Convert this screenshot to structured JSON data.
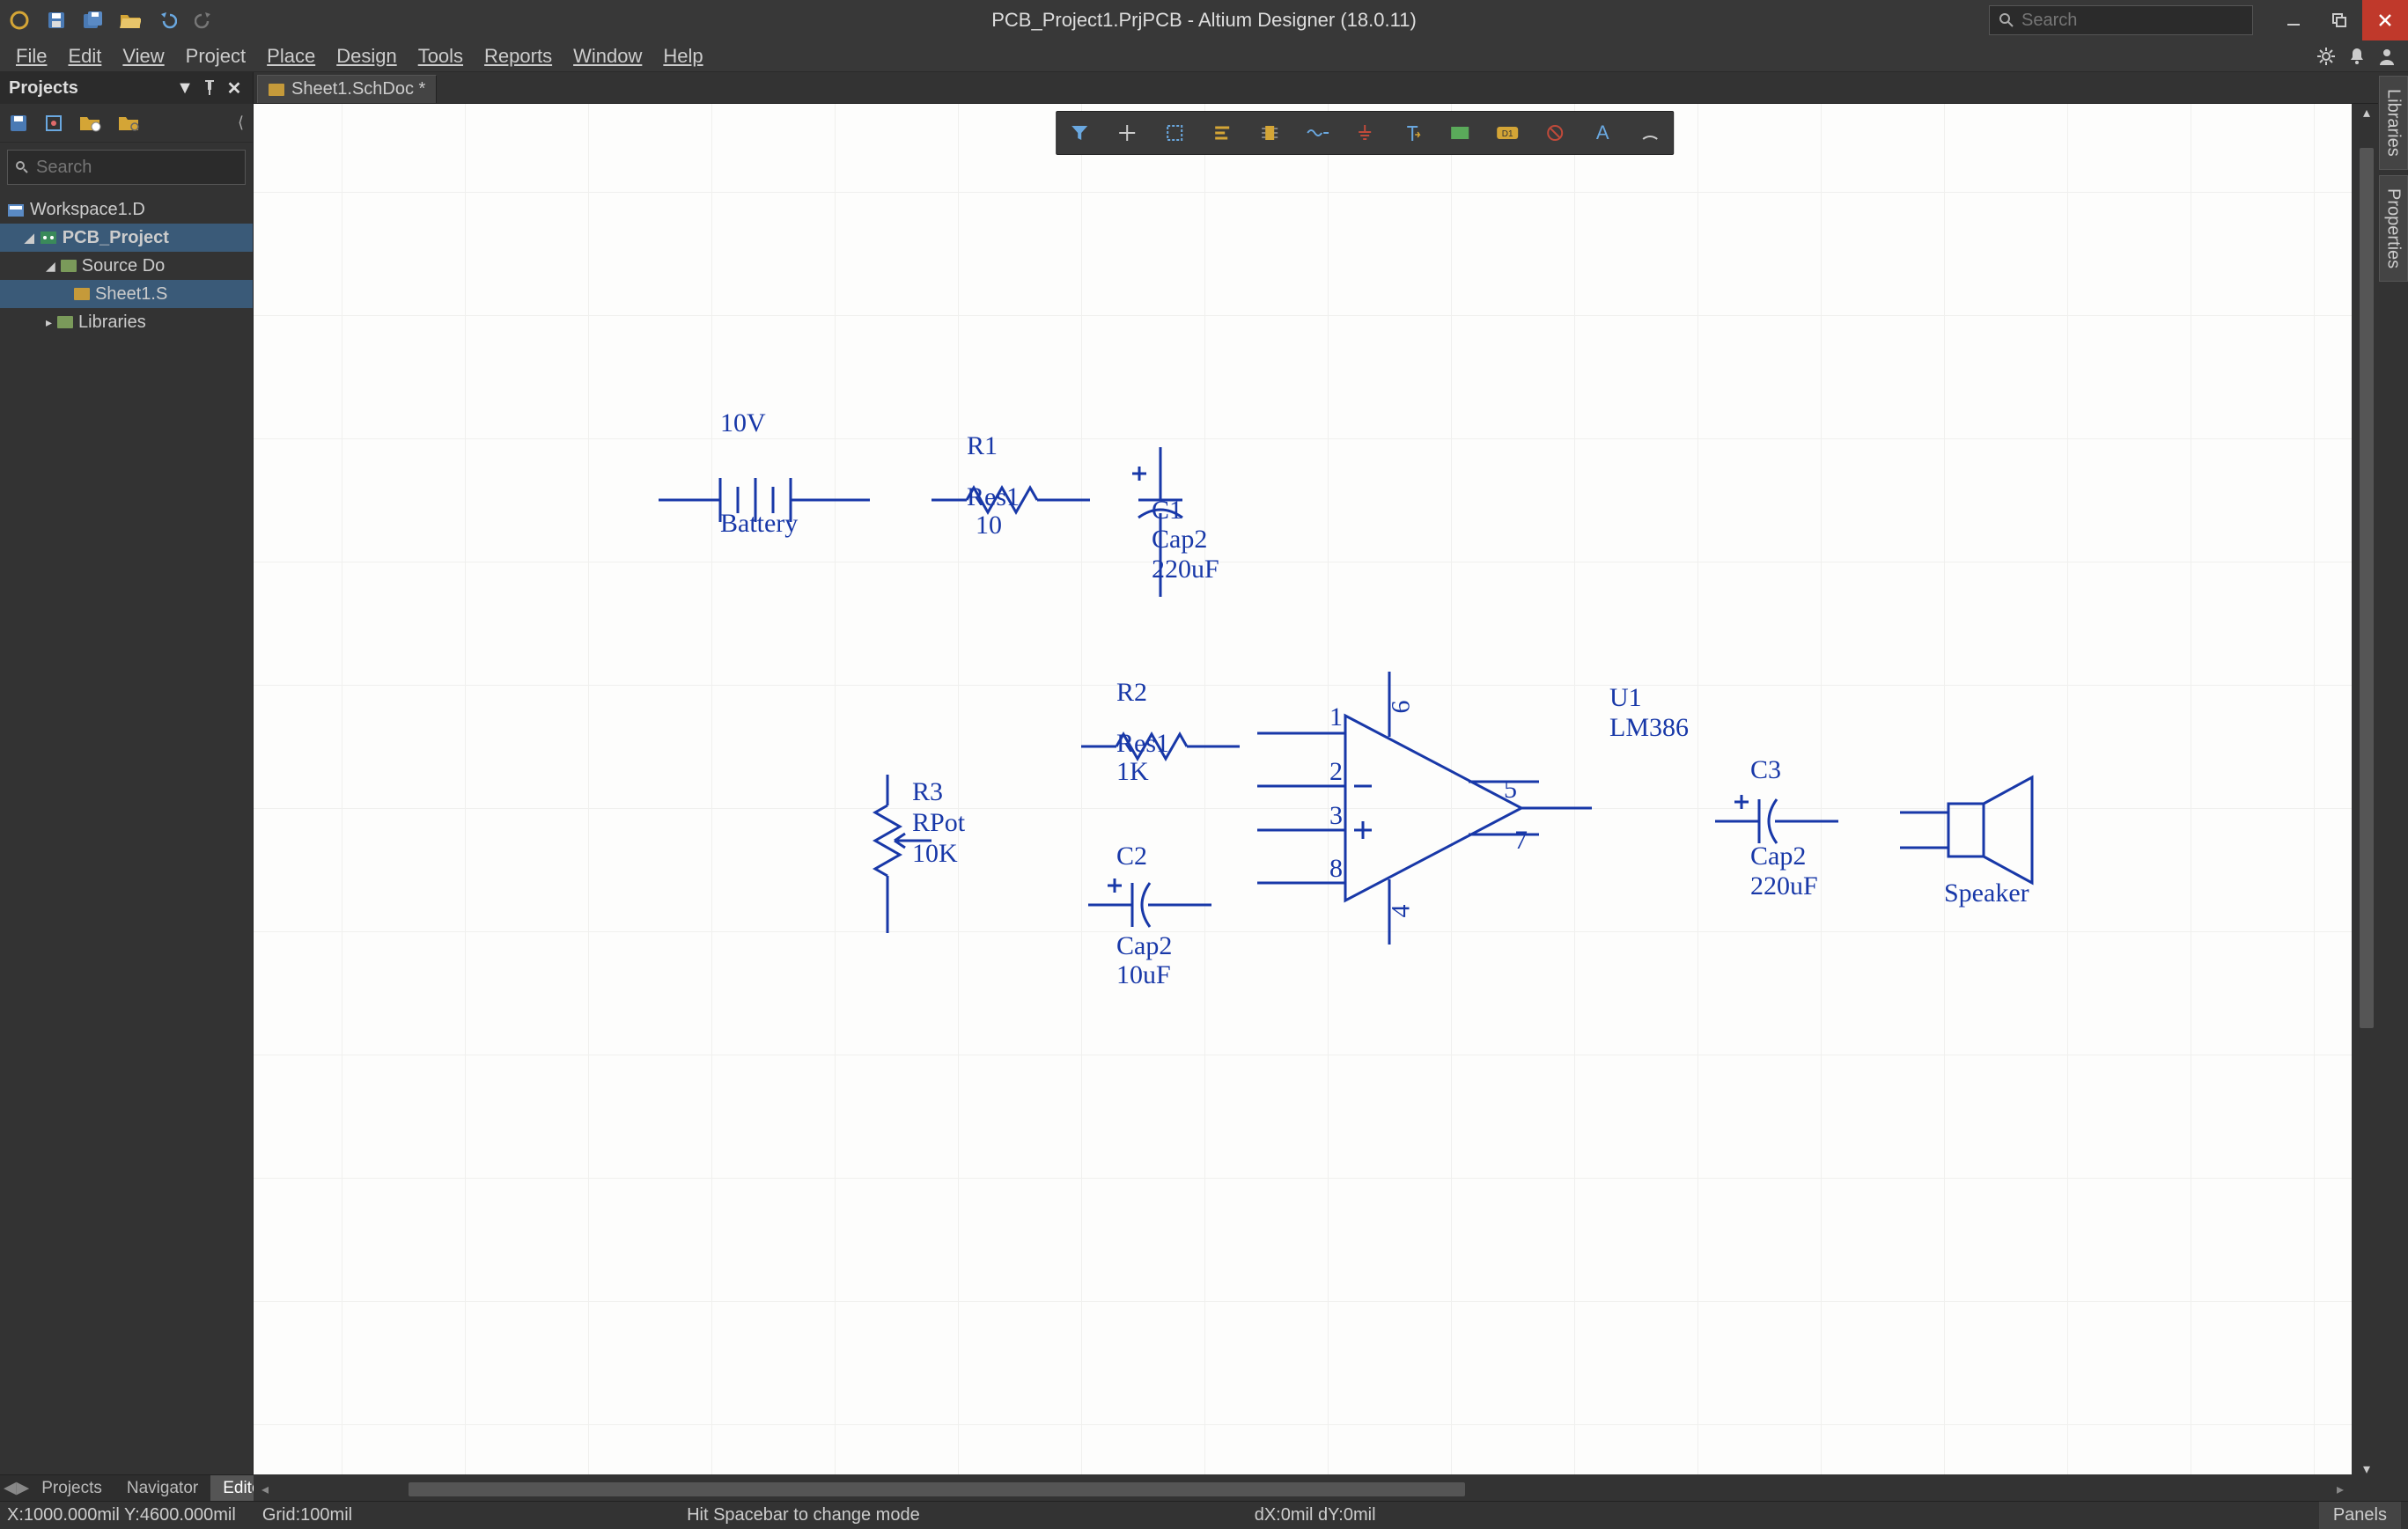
{
  "title": "PCB_Project1.PrjPCB - Altium Designer (18.0.11)",
  "search_placeholder": "Search",
  "menu": [
    "File",
    "Edit",
    "View",
    "Project",
    "Place",
    "Design",
    "Tools",
    "Reports",
    "Window",
    "Help"
  ],
  "panel": {
    "title": "Projects",
    "search_placeholder": "Search",
    "tree": {
      "workspace": "Workspace1.D",
      "project": "PCB_Project",
      "source": "Source Do",
      "sheet": "Sheet1.S",
      "libraries": "Libraries"
    }
  },
  "tab": {
    "label": "Sheet1.SchDoc *"
  },
  "sidetabs": [
    "Libraries",
    "Properties"
  ],
  "bottom_tabs": {
    "projects": "Projects",
    "navigator": "Navigator",
    "editor": "Editor"
  },
  "status": {
    "coords": "X:1000.000mil Y:4600.000mil",
    "grid": "Grid:100mil",
    "hint": "Hit Spacebar to change mode",
    "delta": "dX:0mil dY:0mil",
    "panels": "Panels"
  },
  "components": {
    "battery": {
      "designator": "10V",
      "name": "Battery"
    },
    "r1": {
      "designator": "R1",
      "name": "Res1",
      "value": "10"
    },
    "r2": {
      "designator": "R2",
      "name": "Res1",
      "value": "1K"
    },
    "r3": {
      "designator": "R3",
      "name": "RPot",
      "value": "10K"
    },
    "c1": {
      "designator": "C1",
      "name": "Cap2",
      "value": "220uF"
    },
    "c2": {
      "designator": "C2",
      "name": "Cap2",
      "value": "10uF"
    },
    "c3": {
      "designator": "C3",
      "name": "Cap2",
      "value": "220uF"
    },
    "u1": {
      "designator": "U1",
      "name": "LM386",
      "p1": "1",
      "p2": "2",
      "p3": "3",
      "p4": "4",
      "p5": "5",
      "p6": "6",
      "p7": "7",
      "p8": "8"
    },
    "speaker": {
      "name": "Speaker"
    }
  }
}
